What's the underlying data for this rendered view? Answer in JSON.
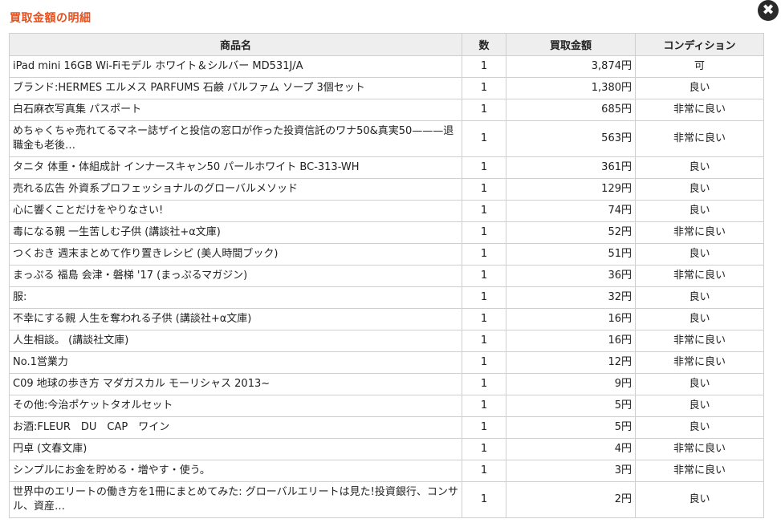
{
  "title": "買取金額の明細",
  "close_label": "✖",
  "headers": [
    "商品名",
    "数",
    "買取金額",
    "コンディション"
  ],
  "rows": [
    {
      "name": "iPad mini 16GB Wi-Fiモデル ホワイト＆シルバー MD531J/A",
      "qty": "1",
      "price": "3,874円",
      "cond": "可"
    },
    {
      "name": "ブランド:HERMES エルメス PARFUMS 石鹸 パルファム ソープ 3個セット",
      "qty": "1",
      "price": "1,380円",
      "cond": "良い"
    },
    {
      "name": "白石麻衣写真集 パスポート",
      "qty": "1",
      "price": "685円",
      "cond": "非常に良い"
    },
    {
      "name": "めちゃくちゃ売れてるマネー誌ザイと投信の窓口が作った投資信託のワナ50&真実50———退職金も老後…",
      "qty": "1",
      "price": "563円",
      "cond": "非常に良い",
      "tall": true
    },
    {
      "name": "タニタ 体重・体組成計 インナースキャン50 パールホワイト BC-313-WH",
      "qty": "1",
      "price": "361円",
      "cond": "良い"
    },
    {
      "name": "売れる広告 外資系プロフェッショナルのグローバルメソッド",
      "qty": "1",
      "price": "129円",
      "cond": "良い"
    },
    {
      "name": "心に響くことだけをやりなさい!",
      "qty": "1",
      "price": "74円",
      "cond": "良い"
    },
    {
      "name": "毒になる親 一生苦しむ子供 (講談社+α文庫)",
      "qty": "1",
      "price": "52円",
      "cond": "非常に良い"
    },
    {
      "name": "つくおき 週末まとめて作り置きレシピ (美人時間ブック)",
      "qty": "1",
      "price": "51円",
      "cond": "良い"
    },
    {
      "name": "まっぷる 福島 会津・磐梯 '17 (まっぷるマガジン)",
      "qty": "1",
      "price": "36円",
      "cond": "非常に良い"
    },
    {
      "name": "服:",
      "qty": "1",
      "price": "32円",
      "cond": "良い"
    },
    {
      "name": "不幸にする親 人生を奪われる子供 (講談社+α文庫)",
      "qty": "1",
      "price": "16円",
      "cond": "良い"
    },
    {
      "name": "人生相談。 (講談社文庫)",
      "qty": "1",
      "price": "16円",
      "cond": "非常に良い"
    },
    {
      "name": "No.1営業力",
      "qty": "1",
      "price": "12円",
      "cond": "非常に良い"
    },
    {
      "name": "C09 地球の歩き方 マダガスカル モーリシャス 2013~",
      "qty": "1",
      "price": "9円",
      "cond": "良い"
    },
    {
      "name": "その他:今治ポケットタオルセット",
      "qty": "1",
      "price": "5円",
      "cond": "良い"
    },
    {
      "name": "お酒:FLEUR　DU　CAP　ワイン",
      "qty": "1",
      "price": "5円",
      "cond": "良い"
    },
    {
      "name": "円卓 (文春文庫)",
      "qty": "1",
      "price": "4円",
      "cond": "非常に良い"
    },
    {
      "name": "シンプルにお金を貯める・増やす・使う。",
      "qty": "1",
      "price": "3円",
      "cond": "非常に良い"
    },
    {
      "name": "世界中のエリートの働き方を1冊にまとめてみた: グローバルエリートは見た!投資銀行、コンサル、資産…",
      "qty": "1",
      "price": "2円",
      "cond": "良い",
      "tall": true
    }
  ]
}
